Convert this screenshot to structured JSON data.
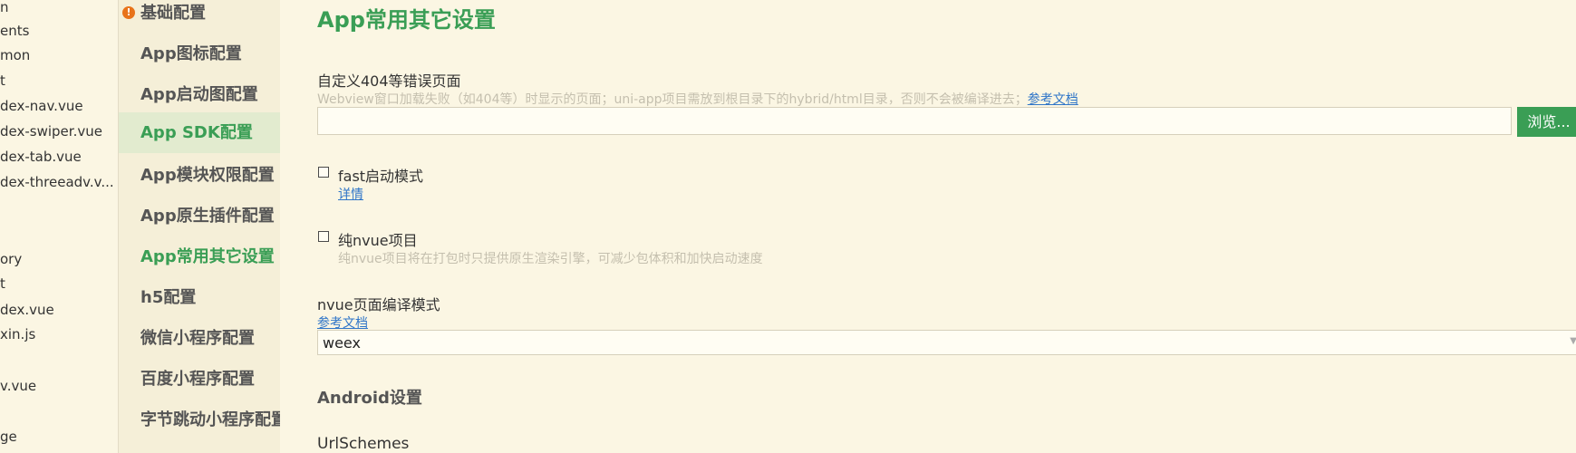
{
  "file_tree": {
    "items": [
      "n",
      "ents",
      "mon",
      "t",
      "dex-nav.vue",
      "dex-swiper.vue",
      "dex-tab.vue",
      "dex-threeadv.v...",
      "ory",
      "t",
      "dex.vue",
      "xin.js",
      "v.vue",
      "ge"
    ]
  },
  "nav": {
    "warning_icon_glyph": "!",
    "items": [
      {
        "label": "基础配置"
      },
      {
        "label": "App图标配置"
      },
      {
        "label": "App启动图配置"
      },
      {
        "label": "App SDK配置"
      },
      {
        "label": "App模块权限配置"
      },
      {
        "label": "App原生插件配置"
      },
      {
        "label": "App常用其它设置"
      },
      {
        "label": "h5配置"
      },
      {
        "label": "微信小程序配置"
      },
      {
        "label": "百度小程序配置"
      },
      {
        "label": "字节跳动小程序配置"
      }
    ]
  },
  "content": {
    "title": "App常用其它设置",
    "error_page": {
      "label": "自定义404等错误页面",
      "hint": "Webview窗口加载失败（如404等）时显示的页面；uni-app项目需放到根目录下的hybrid/html目录，否则不会被编译进去；",
      "link": "参考文档",
      "value": "",
      "browse_label": "浏览..."
    },
    "fast_start": {
      "label": "fast启动模式",
      "link": "详情",
      "checked": false
    },
    "pure_nvue": {
      "label": "纯nvue项目",
      "hint": "纯nvue项目将在打包时只提供原生渲染引擎，可减少包体积和加快启动速度",
      "checked": false
    },
    "nvue_compile": {
      "label": "nvue页面编译模式",
      "link": "参考文档",
      "selected": "weex"
    },
    "android_heading": "Android设置",
    "url_schemes_label": "UrlSchemes"
  },
  "colors": {
    "accent": "#3a9e55",
    "background": "#fbf6e3",
    "link": "#2f75c8",
    "warning": "#e8731a"
  }
}
